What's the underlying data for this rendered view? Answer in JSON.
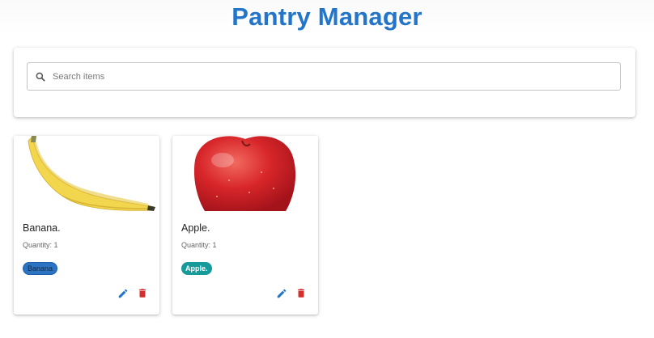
{
  "app": {
    "title": "Pantry Manager",
    "accent_color": "#2275c8"
  },
  "search": {
    "placeholder": "Search items",
    "value": "",
    "icon": "search-icon"
  },
  "items": [
    {
      "name": "Banana.",
      "quantity_text": "Quantity: 1",
      "tag": "Banana",
      "tag_color": "#2b74c4",
      "image": "banana"
    },
    {
      "name": "Apple.",
      "quantity_text": "Quantity: 1",
      "tag": "Apple.",
      "tag_color": "#179a9a",
      "image": "apple"
    }
  ],
  "actions": {
    "edit_icon": "pencil-icon",
    "edit_color": "#2275c8",
    "delete_icon": "trash-icon",
    "delete_color": "#d32f2f"
  }
}
